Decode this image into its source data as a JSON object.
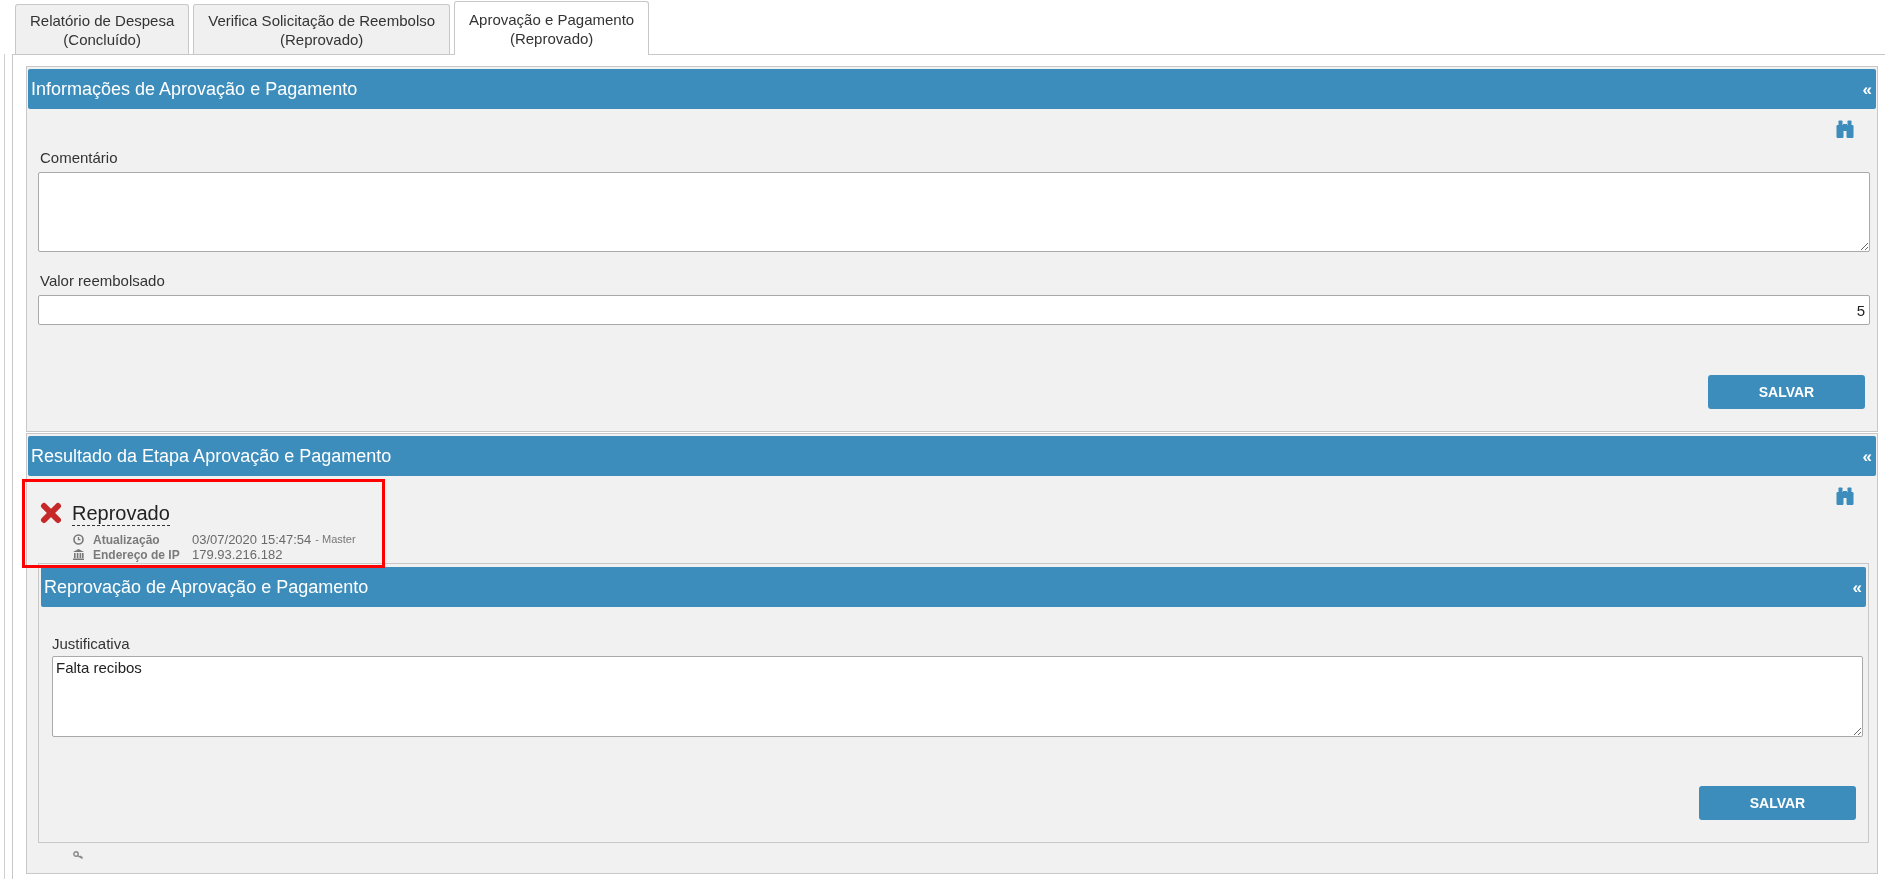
{
  "tabs": [
    {
      "label": "Relatório de Despesa",
      "status": "(Concluído)",
      "selected": false
    },
    {
      "label": "Verifica Solicitação de Reembolso",
      "status": "(Reprovado)",
      "selected": false
    },
    {
      "label": "Aprovação e Pagamento",
      "status": "(Reprovado)",
      "selected": true
    }
  ],
  "sections": [
    {
      "kind": "form",
      "title": "Informações de Aprovação e Pagamento",
      "collapse": "«",
      "fields": [
        {
          "kind": "textarea",
          "label": "Comentário"
        },
        {
          "kind": "input",
          "label": "Valor reembolsado",
          "value": "5"
        }
      ],
      "button": "SALVAR"
    },
    {
      "kind": "result",
      "title": "Resultado da Etapa Aprovação e Pagamento",
      "collapse": "«",
      "result": {
        "status": "Reprovado",
        "highlighted": true,
        "details": [
          {
            "kind": "time",
            "label": "Atualização",
            "value": "03/07/2020 15:47:54",
            "note": "- Master"
          },
          {
            "kind": "ip",
            "label": "Endereço de IP",
            "value": "179.93.216.182"
          }
        ]
      },
      "panel": {
        "title": "Reprovação de Aprovação e Pagamento",
        "collapse": "«",
        "fields": [
          {
            "kind": "textarea",
            "label": "Justificativa",
            "value": "Falta recibos"
          }
        ],
        "button": "SALVAR"
      }
    }
  ]
}
